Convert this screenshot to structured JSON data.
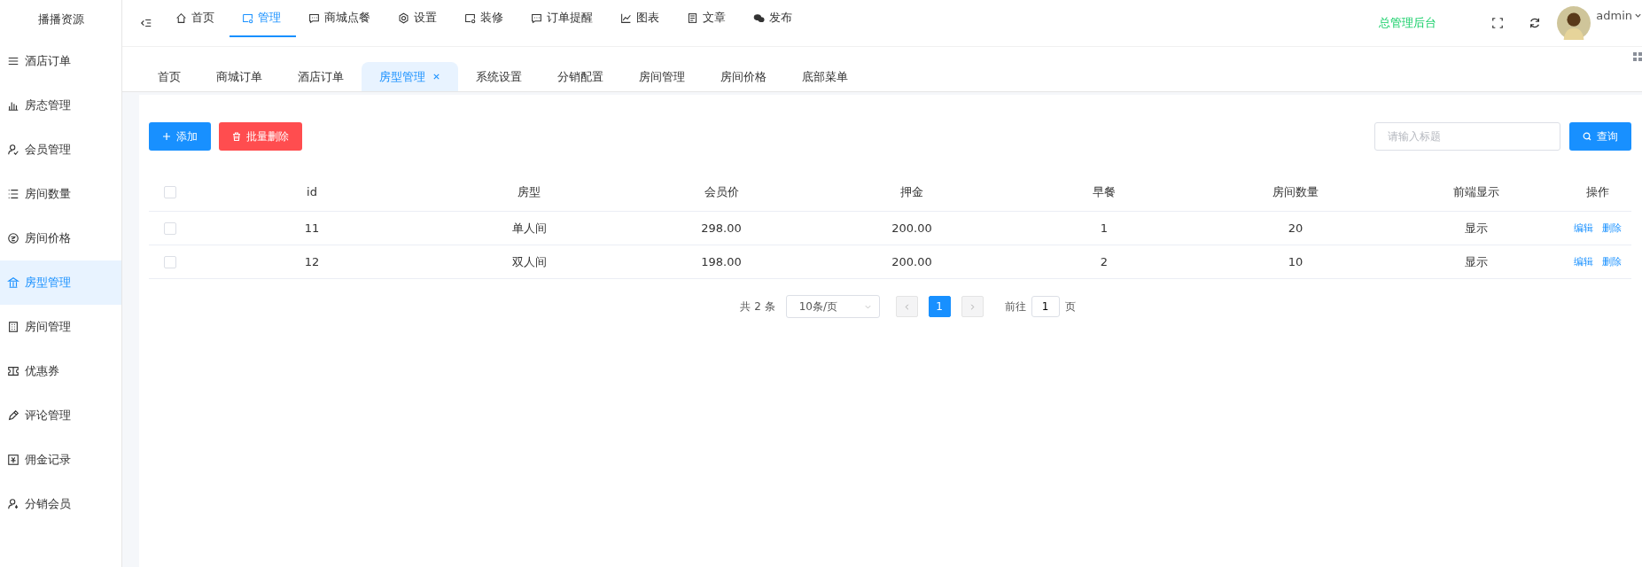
{
  "brand": "播播资源",
  "sidebar": {
    "items": [
      {
        "label": "酒店订单",
        "selected": false
      },
      {
        "label": "房态管理",
        "selected": false
      },
      {
        "label": "会员管理",
        "selected": false
      },
      {
        "label": "房间数量",
        "selected": false
      },
      {
        "label": "房间价格",
        "selected": false
      },
      {
        "label": "房型管理",
        "selected": true
      },
      {
        "label": "房间管理",
        "selected": false
      },
      {
        "label": "优惠券",
        "selected": false
      },
      {
        "label": "评论管理",
        "selected": false
      },
      {
        "label": "佣金记录",
        "selected": false
      },
      {
        "label": "分销会员",
        "selected": false
      }
    ]
  },
  "top_nav": {
    "items": [
      {
        "label": "首页",
        "selected": false
      },
      {
        "label": "管理",
        "selected": true
      },
      {
        "label": "商城点餐",
        "selected": false
      },
      {
        "label": "设置",
        "selected": false
      },
      {
        "label": "装修",
        "selected": false
      },
      {
        "label": "订单提醒",
        "selected": false
      },
      {
        "label": "图表",
        "selected": false
      },
      {
        "label": "文章",
        "selected": false
      },
      {
        "label": "发布",
        "selected": false
      }
    ]
  },
  "header_title": "总管理后台",
  "user": {
    "name": "admin"
  },
  "tabs": [
    {
      "label": "首页",
      "selected": false,
      "closable": false
    },
    {
      "label": "商城订单",
      "selected": false,
      "closable": false
    },
    {
      "label": "酒店订单",
      "selected": false,
      "closable": false
    },
    {
      "label": "房型管理",
      "selected": true,
      "closable": true
    },
    {
      "label": "系统设置",
      "selected": false,
      "closable": false
    },
    {
      "label": "分销配置",
      "selected": false,
      "closable": false
    },
    {
      "label": "房间管理",
      "selected": false,
      "closable": false
    },
    {
      "label": "房间价格",
      "selected": false,
      "closable": false
    },
    {
      "label": "底部菜单",
      "selected": false,
      "closable": false
    }
  ],
  "toolbar": {
    "add_button": "添加",
    "batch_delete_button": "批量删除",
    "search": {
      "placeholder": "请输入标题"
    },
    "search_button": "查询"
  },
  "table": {
    "select_all_checked": false,
    "columns": [
      "id",
      "房型",
      "会员价",
      "押金",
      "早餐",
      "房间数量",
      "前端显示",
      "操作"
    ],
    "rows": [
      {
        "checked": false,
        "cells": [
          "11",
          "单人间",
          "298.00",
          "200.00",
          "1",
          "20",
          "显示"
        ],
        "actions": [
          "编辑",
          "删除"
        ]
      },
      {
        "checked": false,
        "cells": [
          "12",
          "双人间",
          "198.00",
          "200.00",
          "2",
          "10",
          "显示"
        ],
        "actions": [
          "编辑",
          "删除"
        ]
      }
    ]
  },
  "pagination": {
    "total": "共 2 条",
    "page_size": "10条/页",
    "pages": [
      {
        "label": "1",
        "selected": true
      }
    ],
    "goto_label": "前往",
    "goto_value": "1",
    "page_unit": "页"
  }
}
